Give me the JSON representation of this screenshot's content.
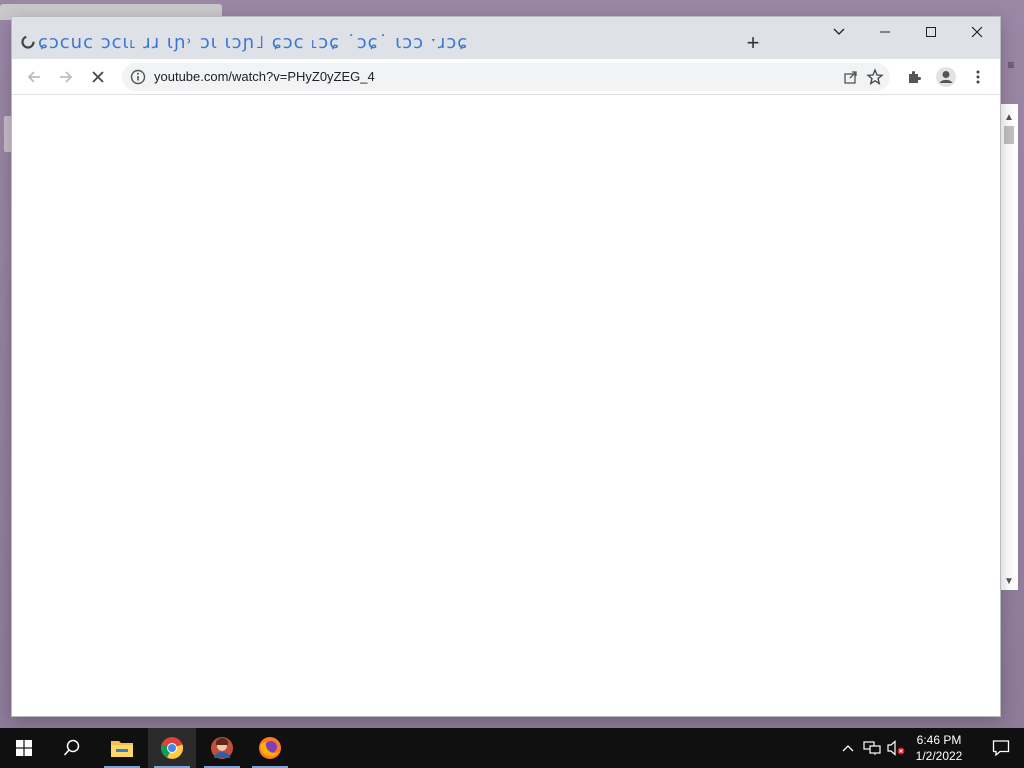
{
  "browser": {
    "tab": {
      "title": "ɕɔcuc ɔcɩ˪ ɹɹ ɩɲ˒ ɔɩ ɩɔɲ˩ ɕɔc ˪ɔɕ ˙ɔɕ˙ ɩɔɔ ˑɹɔɕ",
      "favicon_icon": "loading-favicon-icon"
    },
    "new_tab_label": "+",
    "address": {
      "url": "youtube.com/watch?v=PHyZ0yZEG_4"
    },
    "window_controls": [
      "tab-search-icon",
      "minimize-icon",
      "maximize-icon",
      "close-icon"
    ],
    "toolbar_icons": [
      "back-arrow-icon",
      "forward-arrow-icon",
      "stop-icon",
      "info-icon",
      "share-icon",
      "star-icon",
      "puzzle-icon",
      "profile-icon",
      "kebab-menu-icon"
    ]
  },
  "desktop": {
    "bg_menu_glyph": "≡"
  },
  "taskbar": {
    "apps": [
      "windows-start-icon",
      "search-icon",
      "file-explorer-icon",
      "chrome-icon",
      "user-avatar-icon",
      "firefox-icon"
    ],
    "tray": {
      "chevron": "^",
      "time": "6:46 PM",
      "date": "1/2/2022"
    },
    "accent_color": "#7aa6d8"
  }
}
